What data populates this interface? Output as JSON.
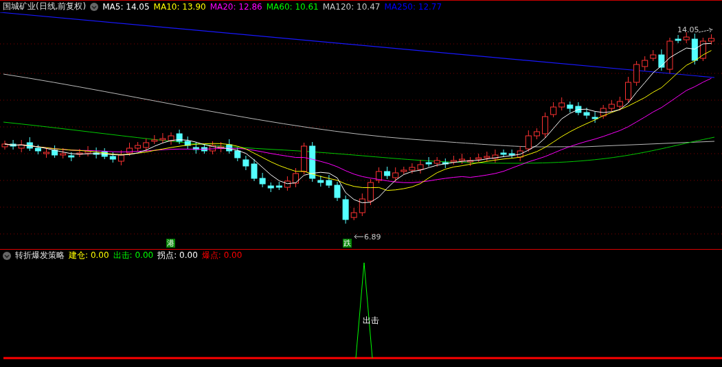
{
  "title": "国城矿业(日线,前复权)",
  "ma_legend": [
    {
      "label": "MA5: 14.05",
      "color": "#ffffff"
    },
    {
      "label": "MA10: 13.90",
      "color": "#ffff00"
    },
    {
      "label": "MA20: 12.86",
      "color": "#ff00ff"
    },
    {
      "label": "MA60: 10.61",
      "color": "#00ff00"
    },
    {
      "label": "MA120: 10.47",
      "color": "#c8c8c8"
    },
    {
      "label": "MA250: 12.77",
      "color": "#0000ff"
    }
  ],
  "main_chart": {
    "high_label": "14.05",
    "low_label": "6.89",
    "markers": [
      {
        "text": "港"
      },
      {
        "text": "跌"
      }
    ]
  },
  "indicator": {
    "name": "转折爆发策略",
    "values": [
      {
        "label": "建仓:",
        "value": "0.00",
        "color": "#ffff00"
      },
      {
        "label": "出击:",
        "value": "0.00",
        "color": "#00ff00"
      },
      {
        "label": "拐点:",
        "value": "0.00",
        "color": "#ffffff"
      },
      {
        "label": "爆点:",
        "value": "0.00",
        "color": "#ff0000"
      }
    ],
    "signal_label": "出击"
  }
}
